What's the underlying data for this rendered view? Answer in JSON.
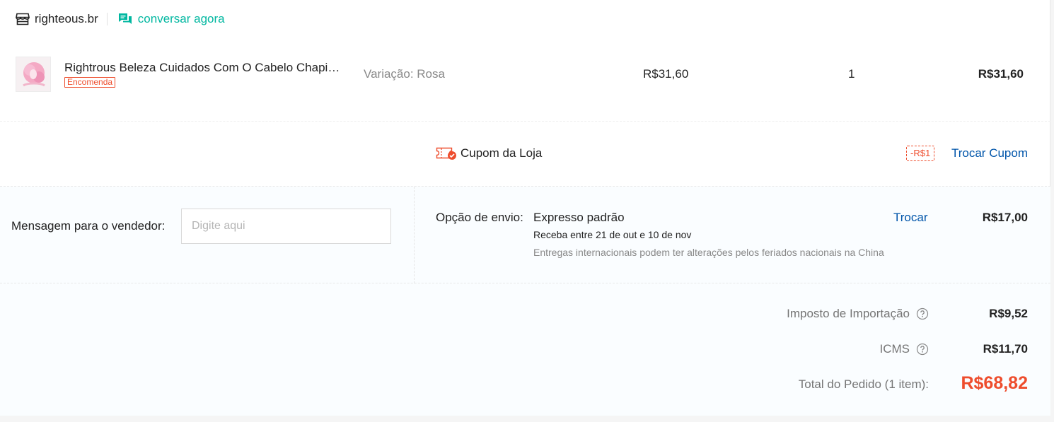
{
  "shop": {
    "name": "righteous.br",
    "chat_label": "conversar agora"
  },
  "product": {
    "name": "Rightrous Beleza Cuidados Com O Cabelo Chapinha",
    "badge": "Encomenda",
    "variation": "Variação: Rosa",
    "unit_price": "R$31,60",
    "quantity": "1",
    "subtotal": "R$31,60"
  },
  "coupon": {
    "label": "Cupom da Loja",
    "value": "-R$1",
    "change_label": "Trocar Cupom"
  },
  "message": {
    "label": "Mensagem para o vendedor:",
    "placeholder": "Digite aqui",
    "value": ""
  },
  "shipping": {
    "label": "Opção de envio:",
    "method": "Expresso padrão",
    "eta": "Receba entre 21 de out e 10 de nov",
    "note": "Entregas internacionais podem ter alterações pelos feriados nacionais na China",
    "change_label": "Trocar",
    "price": "R$17,00"
  },
  "totals": {
    "import_tax_label": "Imposto de Importação",
    "import_tax_value": "R$9,52",
    "icms_label": "ICMS",
    "icms_value": "R$11,70",
    "order_total_label": "Total do Pedido (1 item):",
    "order_total_value": "R$68,82"
  },
  "colors": {
    "accent": "#ee4d2d",
    "link": "#0055aa",
    "chat": "#00b7a0"
  },
  "icons": {
    "shop": "store-icon",
    "chat": "chat-bubble-icon",
    "coupon": "coupon-ticket-icon",
    "help": "question-circle-icon"
  }
}
